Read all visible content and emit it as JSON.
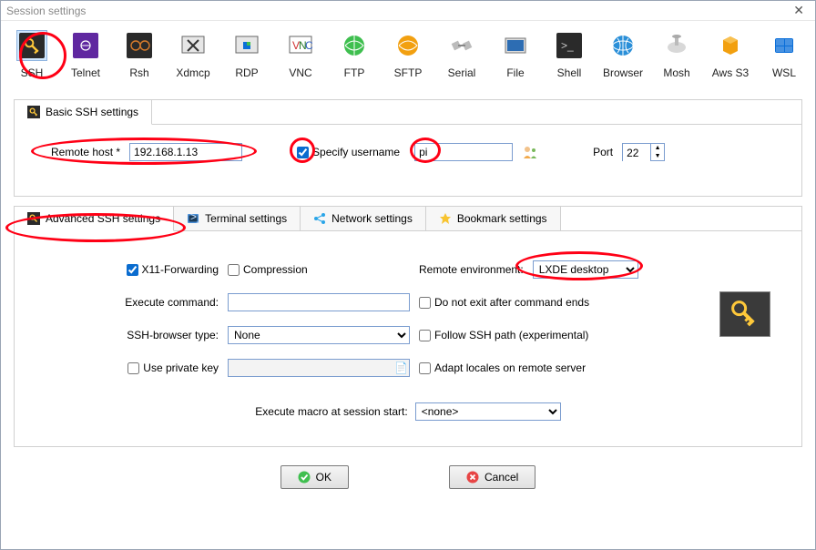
{
  "title": "Session settings",
  "protocols": [
    {
      "label": "SSH",
      "name": "protocol-ssh",
      "selected": true
    },
    {
      "label": "Telnet",
      "name": "protocol-telnet"
    },
    {
      "label": "Rsh",
      "name": "protocol-rsh"
    },
    {
      "label": "Xdmcp",
      "name": "protocol-xdmcp"
    },
    {
      "label": "RDP",
      "name": "protocol-rdp"
    },
    {
      "label": "VNC",
      "name": "protocol-vnc"
    },
    {
      "label": "FTP",
      "name": "protocol-ftp"
    },
    {
      "label": "SFTP",
      "name": "protocol-sftp"
    },
    {
      "label": "Serial",
      "name": "protocol-serial"
    },
    {
      "label": "File",
      "name": "protocol-file"
    },
    {
      "label": "Shell",
      "name": "protocol-shell"
    },
    {
      "label": "Browser",
      "name": "protocol-browser"
    },
    {
      "label": "Mosh",
      "name": "protocol-mosh"
    },
    {
      "label": "Aws S3",
      "name": "protocol-aws"
    },
    {
      "label": "WSL",
      "name": "protocol-wsl"
    }
  ],
  "basic": {
    "tab_label": "Basic SSH settings",
    "remote_host_label": "Remote host *",
    "remote_host_value": "192.168.1.13",
    "specify_username_label": "Specify username",
    "specify_username_checked": true,
    "username_value": "pi",
    "port_label": "Port",
    "port_value": "22"
  },
  "tabs": {
    "adv": "Advanced SSH settings",
    "term": "Terminal settings",
    "net": "Network settings",
    "book": "Bookmark settings"
  },
  "adv": {
    "x11_label": "X11-Forwarding",
    "comp_label": "Compression",
    "reenv_label": "Remote environment:",
    "reenv_value": "LXDE desktop",
    "exec_label": "Execute command:",
    "exec_value": "",
    "noexit_label": "Do not exit after command ends",
    "browser_label": "SSH-browser type:",
    "browser_value": "None",
    "follow_label": "Follow SSH path (experimental)",
    "pk_label": "Use private key",
    "pk_value": "",
    "adapt_label": "Adapt locales on remote server",
    "macro_label": "Execute macro at session start:",
    "macro_value": "<none>"
  },
  "ok_label": "OK",
  "cancel_label": "Cancel"
}
